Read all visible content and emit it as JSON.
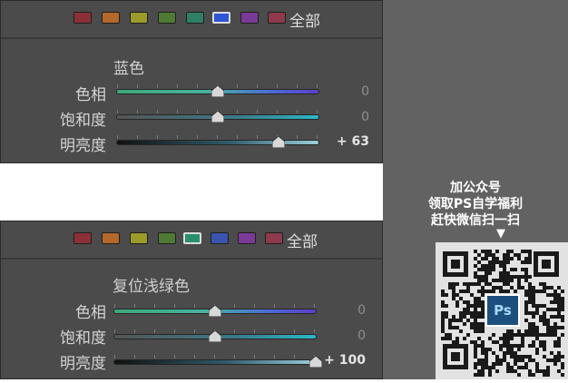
{
  "panels": [
    {
      "swatches": [
        {
          "color": "#8b3037",
          "selected": false
        },
        {
          "color": "#b5682c",
          "selected": false
        },
        {
          "color": "#9c9a28",
          "selected": false
        },
        {
          "color": "#4f7a34",
          "selected": false
        },
        {
          "color": "#2f7f67",
          "selected": false
        },
        {
          "color": "#2e55d6",
          "selected": true
        },
        {
          "color": "#7b3a97",
          "selected": false
        },
        {
          "color": "#8e3a4c",
          "selected": false
        }
      ],
      "all_label": "全部",
      "title": "蓝色",
      "rows": [
        {
          "label": "色相",
          "value": "0",
          "level": 0.5,
          "track": "hue"
        },
        {
          "label": "饱和度",
          "value": "0",
          "level": 0.5,
          "track": "sat"
        },
        {
          "label": "明亮度",
          "value": "+ 63",
          "level": 0.8,
          "track": "lum"
        }
      ]
    },
    {
      "swatches": [
        {
          "color": "#8b3037",
          "selected": false
        },
        {
          "color": "#b5682c",
          "selected": false
        },
        {
          "color": "#9c9a28",
          "selected": false
        },
        {
          "color": "#4f7a34",
          "selected": false
        },
        {
          "color": "#2a8f6e",
          "selected": true
        },
        {
          "color": "#3a54b0",
          "selected": false
        },
        {
          "color": "#7b3a97",
          "selected": false
        },
        {
          "color": "#8e3a4c",
          "selected": false
        }
      ],
      "all_label": "全部",
      "title": "复位浅绿色",
      "rows": [
        {
          "label": "色相",
          "value": "0",
          "level": 0.5,
          "track": "hue"
        },
        {
          "label": "饱和度",
          "value": "0",
          "level": 0.5,
          "track": "sat"
        },
        {
          "label": "明亮度",
          "value": "+ 100",
          "level": 1.0,
          "track": "lum"
        }
      ]
    }
  ],
  "promo": {
    "line1": "加公众号",
    "line2": "领取PS自学福利",
    "line3": "赶快微信扫一扫",
    "arrow": "▼",
    "badge": "Ps"
  },
  "track_colors": {
    "hue": "linear-gradient(90deg,#3ea878,#4ab0a0 45%,#4a6fd0 75%,#5a3ec8)",
    "sat": "linear-gradient(90deg,#555555,#3a7a8a 60%,#2ab8c8)",
    "lum": "linear-gradient(90deg,#111111,#2f5a6a 55%,#9ad0dc)"
  }
}
